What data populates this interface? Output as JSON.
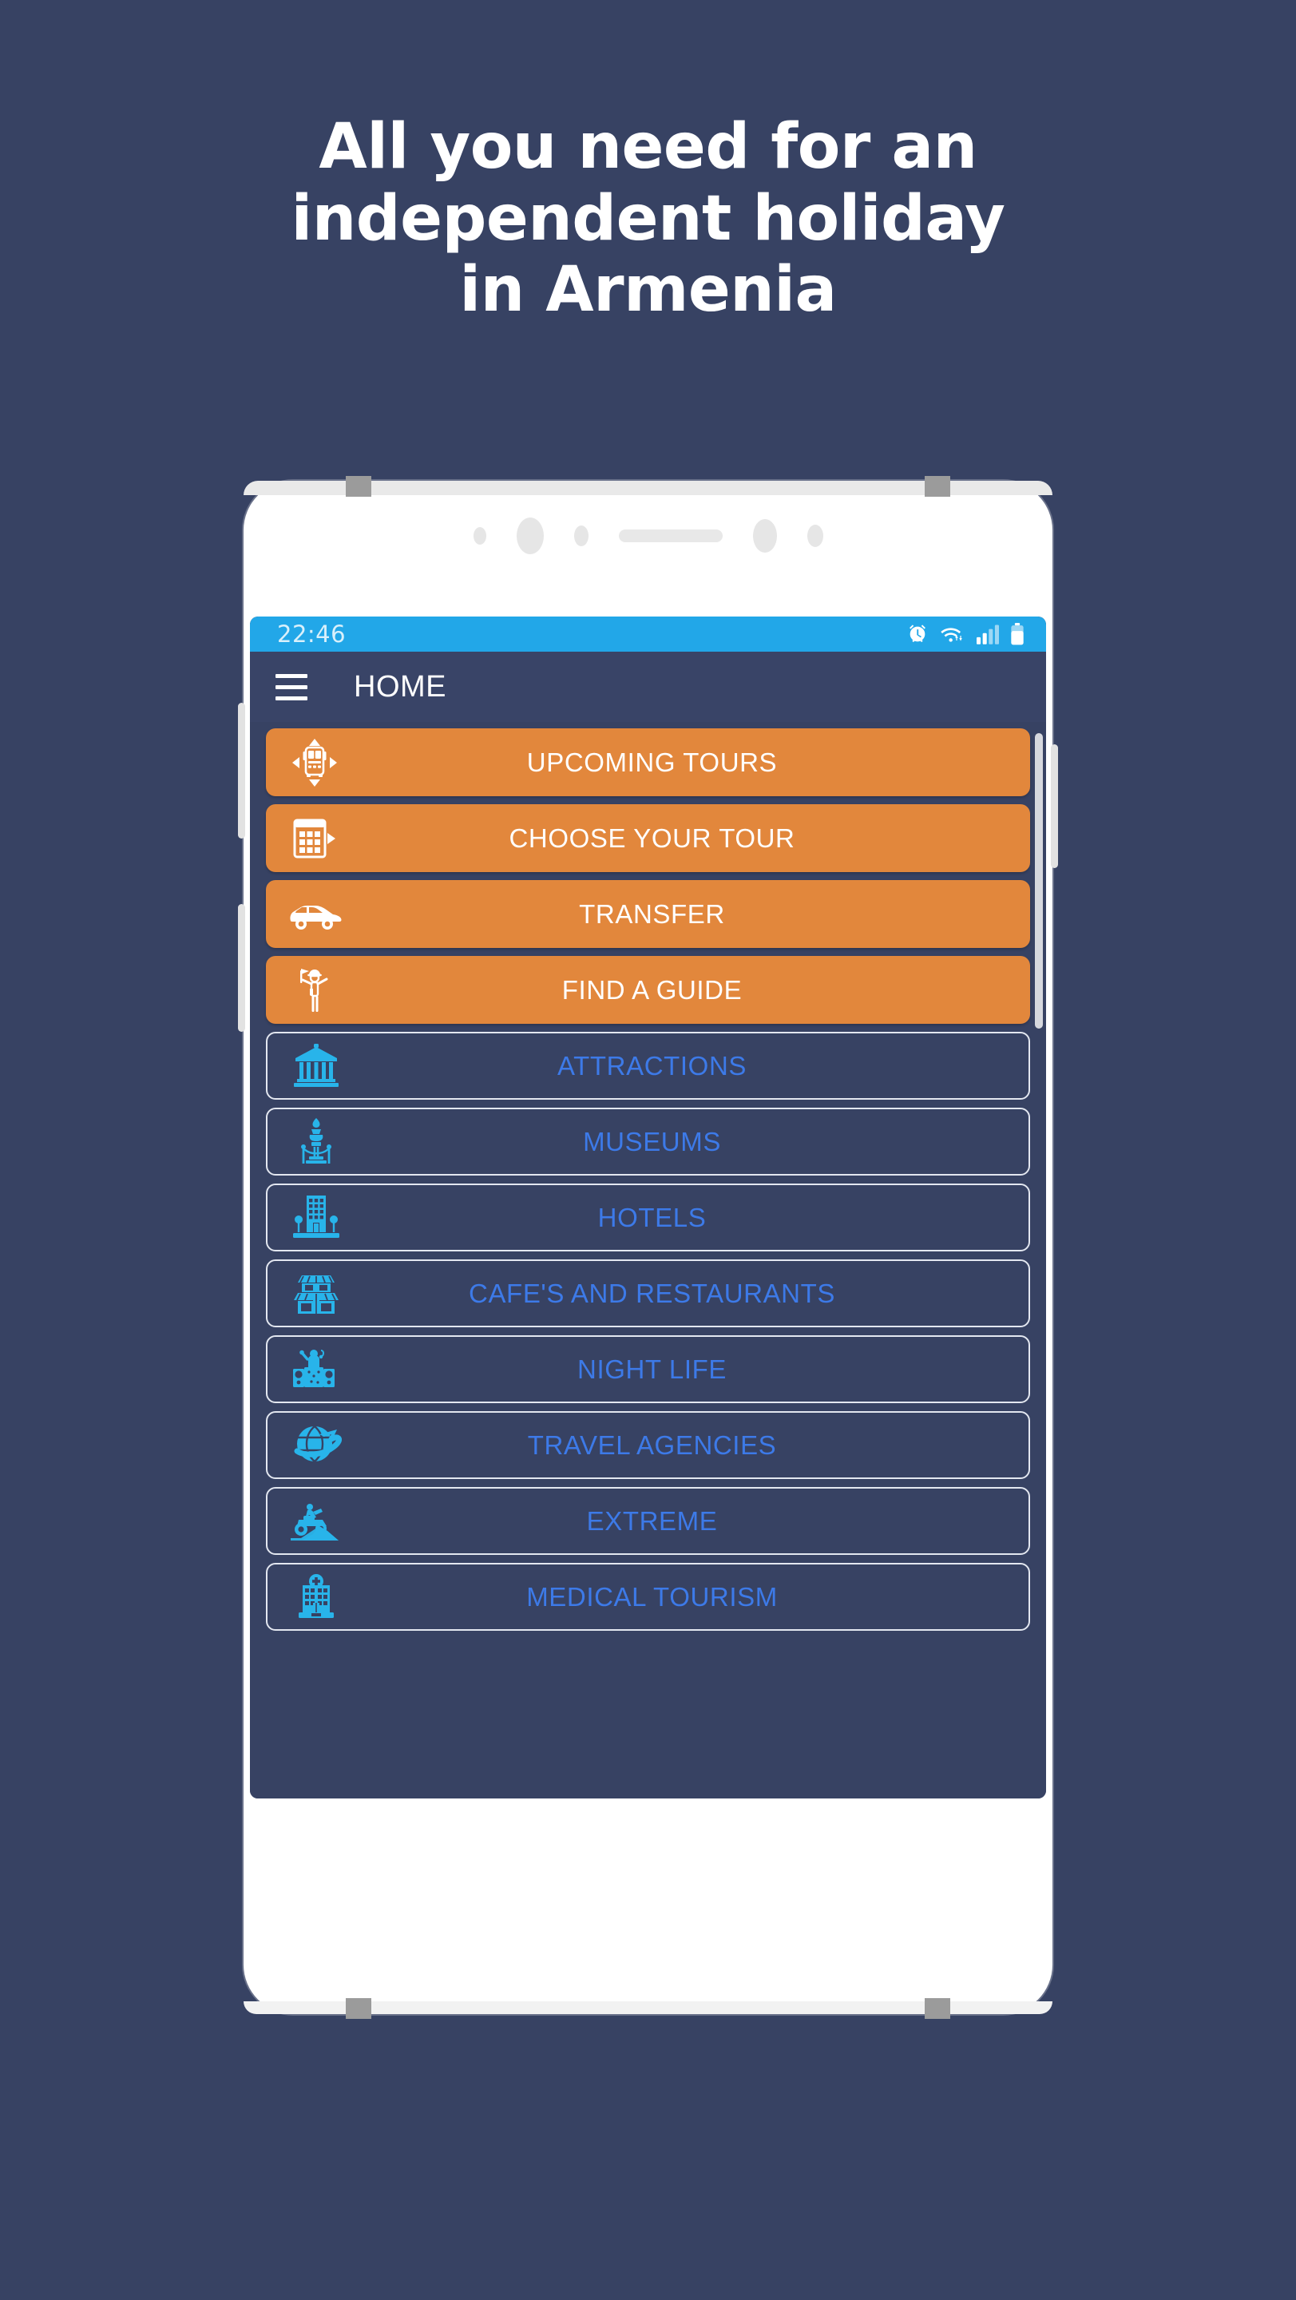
{
  "headline": {
    "line1": "All you need for an",
    "line2": "independent holiday",
    "line3": "in Armenia"
  },
  "colors": {
    "background": "#374263",
    "primary_button": "#e2873c",
    "secondary_text": "#3d7ae8",
    "statusbar": "#22a7e8",
    "appbar": "#394467",
    "border": "#e3e7f0"
  },
  "phone": {
    "statusbar": {
      "time": "22:46",
      "icons": [
        "alarm-icon",
        "wifi-icon",
        "signal-icon",
        "battery-icon"
      ]
    },
    "appbar": {
      "menu_icon": "hamburger-menu-icon",
      "title": "HOME"
    },
    "menu": {
      "primary_items": [
        {
          "label": "UPCOMING TOURS",
          "icon": "bus-with-arrows-icon"
        },
        {
          "label": "CHOOSE YOUR TOUR",
          "icon": "calendar-grid-icon"
        },
        {
          "label": "TRANSFER",
          "icon": "car-icon"
        },
        {
          "label": "FIND A GUIDE",
          "icon": "tour-guide-icon"
        }
      ],
      "secondary_items": [
        {
          "label": "ATTRACTIONS",
          "icon": "temple-icon"
        },
        {
          "label": "MUSEUMS",
          "icon": "statue-exhibit-icon"
        },
        {
          "label": "HOTELS",
          "icon": "hotel-building-icon"
        },
        {
          "label": "CAFE'S AND RESTAURANTS",
          "icon": "storefront-icon"
        },
        {
          "label": "NIGHT LIFE",
          "icon": "dj-speakers-icon"
        },
        {
          "label": "TRAVEL AGENCIES",
          "icon": "globe-plane-icon"
        },
        {
          "label": "EXTREME",
          "icon": "atv-quadbike-icon"
        },
        {
          "label": "MEDICAL TOURISM",
          "icon": "hospital-icon"
        }
      ]
    },
    "navbar": {
      "recents": "recents-icon",
      "home": "home-icon",
      "back": "back-icon"
    }
  }
}
